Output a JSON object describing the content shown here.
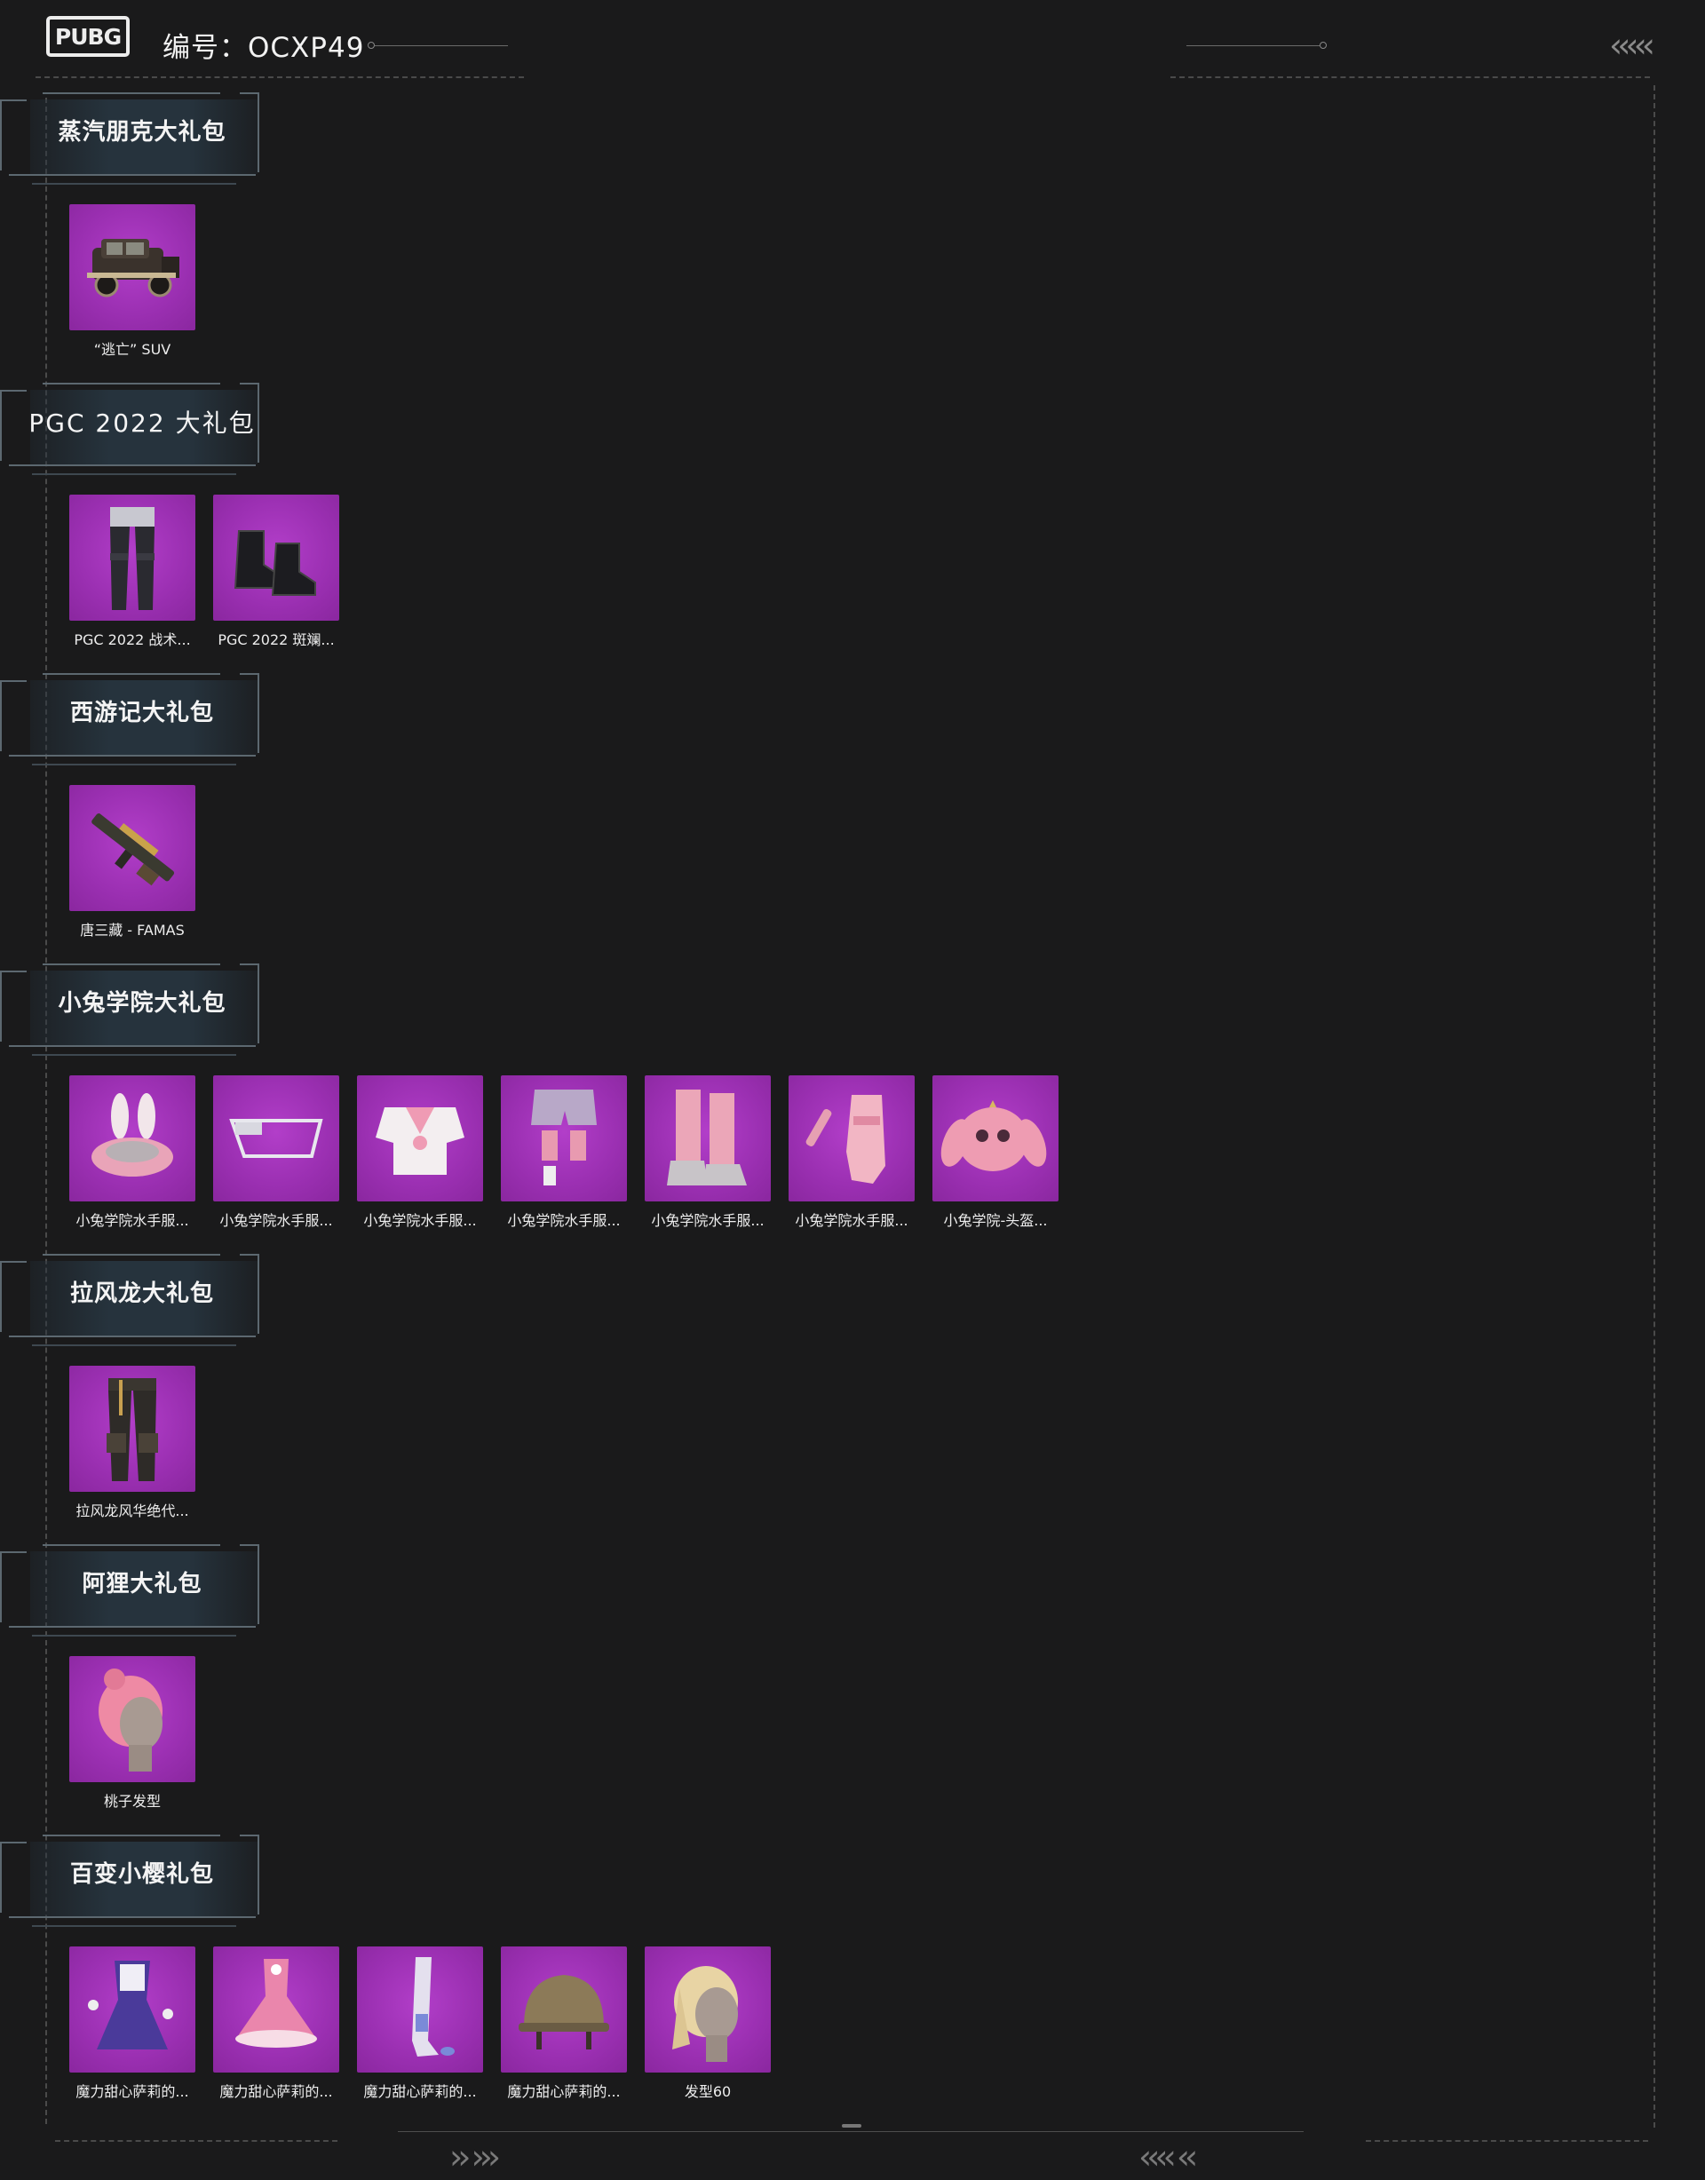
{
  "header": {
    "logo_text": "PUBG",
    "serial_label": "编号：OCXP49"
  },
  "sections": [
    {
      "title": "蒸汽朋克大礼包",
      "items": [
        {
          "label": "“逃亡” SUV",
          "icon": "vintage-car-icon"
        }
      ]
    },
    {
      "title": "PGC 2022 大礼包",
      "items": [
        {
          "label": "PGC 2022 战术...",
          "icon": "tactical-pants-icon"
        },
        {
          "label": "PGC 2022 斑斓...",
          "icon": "boots-icon"
        }
      ]
    },
    {
      "title": "西游记大礼包",
      "items": [
        {
          "label": "唐三藏 - FAMAS",
          "icon": "rifle-icon"
        }
      ]
    },
    {
      "title": "小兔学院大礼包",
      "items": [
        {
          "label": "小兔学院水手服...",
          "icon": "bunny-hat-icon"
        },
        {
          "label": "小兔学院水手服...",
          "icon": "mask-icon"
        },
        {
          "label": "小兔学院水手服...",
          "icon": "sailor-top-icon"
        },
        {
          "label": "小兔学院水手服...",
          "icon": "shorts-icon"
        },
        {
          "label": "小兔学院水手服...",
          "icon": "pink-boots-icon"
        },
        {
          "label": "小兔学院水手服...",
          "icon": "gloves-icon"
        },
        {
          "label": "小兔学院-头盔...",
          "icon": "bunny-helmet-icon"
        }
      ]
    },
    {
      "title": "拉风龙大礼包",
      "items": [
        {
          "label": "拉风龙风华绝代...",
          "icon": "cargo-pants-icon"
        }
      ]
    },
    {
      "title": "阿狸大礼包",
      "items": [
        {
          "label": "桃子发型",
          "icon": "pink-hair-icon"
        }
      ]
    },
    {
      "title": "百变小樱礼包",
      "items": [
        {
          "label": "魔力甜心萨莉的...",
          "icon": "dress-icon"
        },
        {
          "label": "魔力甜心萨莉的...",
          "icon": "pink-dress-icon"
        },
        {
          "label": "魔力甜心萨莉的...",
          "icon": "stockings-icon"
        },
        {
          "label": "魔力甜心萨莉的...",
          "icon": "helmet-icon"
        },
        {
          "label": "发型60",
          "icon": "blonde-hair-icon"
        }
      ]
    }
  ],
  "colors": {
    "background": "#1a1a1b",
    "item_bg": "#a235bb",
    "banner_bg": "#26333d"
  }
}
